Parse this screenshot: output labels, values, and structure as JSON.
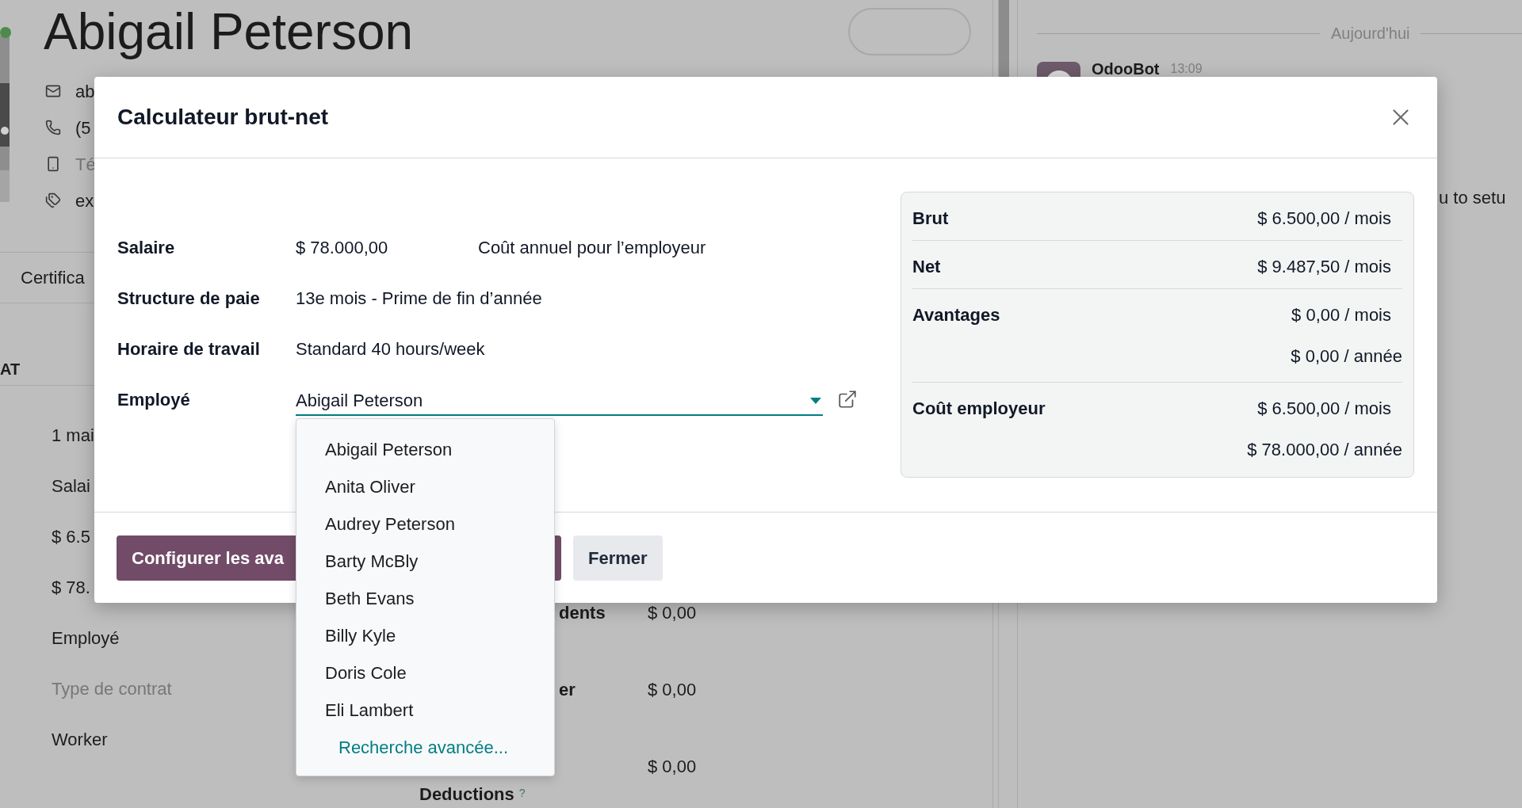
{
  "background": {
    "title": "Abigail Peterson",
    "contacts": [
      {
        "kind": "email",
        "text": "ab",
        "muted": false
      },
      {
        "kind": "phone",
        "text": "(5",
        "muted": false
      },
      {
        "kind": "mobile",
        "text": "Té",
        "muted": true
      },
      {
        "kind": "tags",
        "text": "ex",
        "muted": false
      }
    ],
    "tab": "Certifica",
    "section": "AT",
    "fields": [
      {
        "text": "1 mai",
        "muted": false
      },
      {
        "text": "Salai",
        "muted": false
      },
      {
        "text": "$ 6.5",
        "muted": false
      },
      {
        "text": "$ 78.",
        "muted": false
      },
      {
        "text": "Employé",
        "muted": false
      },
      {
        "text": "Type de contrat",
        "muted": true
      },
      {
        "text": "Worker",
        "muted": false
      }
    ],
    "amounts": [
      {
        "label": "dents",
        "value": "$ 0,00"
      },
      {
        "label": "er",
        "value": "$ 0,00"
      },
      {
        "value": "$ 0,00"
      }
    ],
    "deductions": {
      "label": "Deductions",
      "help": "?"
    }
  },
  "chatter": {
    "date": "Aujourd'hui",
    "author": "OdooBot",
    "time": "13:09",
    "message": "u to setu"
  },
  "dialog": {
    "title": "Calculateur brut-net",
    "fields": [
      {
        "kind": "text",
        "label": "Salaire",
        "value": "$ 78.000,00",
        "note": "Coût annuel pour l’employeur"
      },
      {
        "kind": "text",
        "label": "Structure de paie",
        "value": "13e mois - Prime de fin d’année"
      },
      {
        "kind": "text",
        "label": "Horaire de travail",
        "value": "Standard 40 hours/week"
      },
      {
        "kind": "select",
        "label": "Employé",
        "value": "Abigail Peterson"
      }
    ],
    "dropdown": {
      "options": [
        "Abigail Peterson",
        "Anita Oliver",
        "Audrey Peterson",
        "Barty McBly",
        "Beth Evans",
        "Billy Kyle",
        "Doris Cole",
        "Eli Lambert"
      ],
      "footer": "Recherche avancée..."
    },
    "summary": [
      {
        "label": "Brut",
        "values": [
          "$ 6.500,00 / mois"
        ]
      },
      {
        "label": "Net",
        "values": [
          "$ 9.487,50 / mois"
        ]
      },
      {
        "label": "Avantages",
        "values": [
          "$ 0,00 / mois",
          "$ 0,00 / année"
        ]
      },
      {
        "label": "Coût employeur",
        "values": [
          "$ 6.500,00 / mois",
          "$ 78.000,00 / année"
        ]
      }
    ],
    "buttons": [
      {
        "kind": "primary",
        "label": "Configurer les ava"
      },
      {
        "kind": "secondary",
        "label": "Fermer"
      }
    ]
  }
}
